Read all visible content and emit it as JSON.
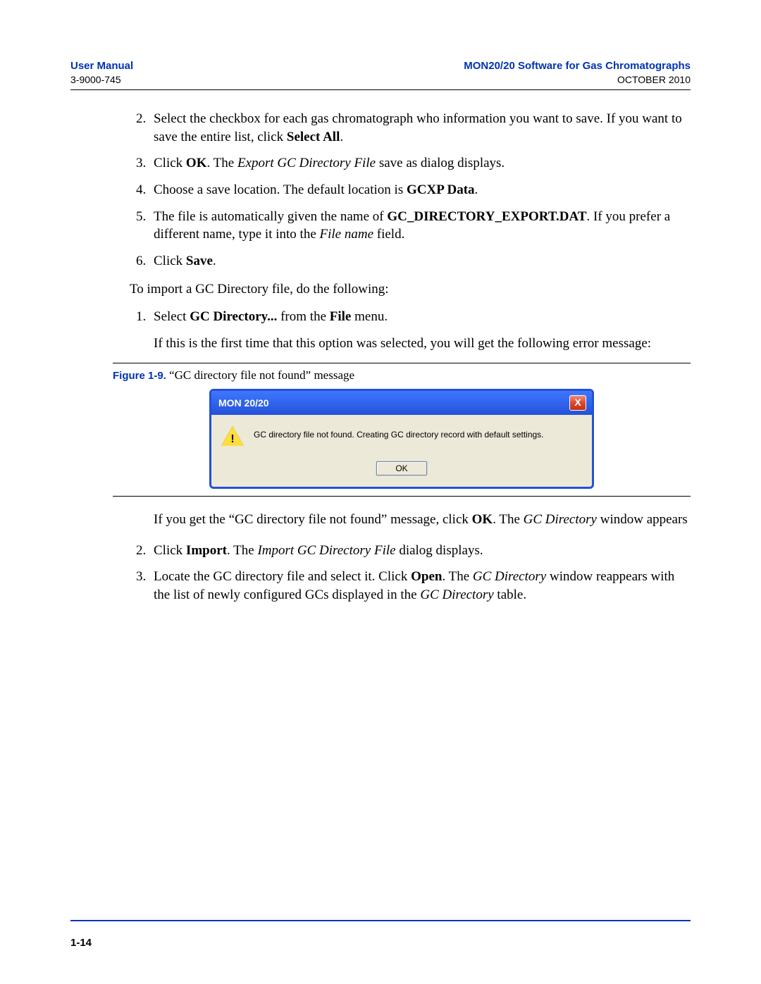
{
  "header": {
    "left_title": "User Manual",
    "left_sub": "3-9000-745",
    "right_title": "MON20/20 Software for Gas Chromatographs",
    "right_sub": "OCTOBER 2010"
  },
  "list1": {
    "i2_a": "Select the checkbox for each gas chromatograph who information you want to save.  If you want to save the entire list, click ",
    "i2_b": "Select All",
    "i2_c": ".",
    "i3_a": "Click ",
    "i3_b": "OK",
    "i3_c": ".  The ",
    "i3_d": "Export GC Directory File",
    "i3_e": " save as dialog displays.",
    "i4_a": "Choose a save location.  The default location is ",
    "i4_b": "GCXP Data",
    "i4_c": ".",
    "i5_a": "The file is automatically given the name of ",
    "i5_b": "GC_DIRECTORY_EXPORT.DAT",
    "i5_c": ".  If you prefer a different name, type it into the ",
    "i5_d": "File name",
    "i5_e": " field.",
    "i6_a": "Click ",
    "i6_b": "Save",
    "i6_c": "."
  },
  "para1": "To import a GC Directory file, do the following:",
  "list2": {
    "i1_a": "Select ",
    "i1_b": "GC Directory...",
    "i1_c": " from the ",
    "i1_d": "File",
    "i1_e": " menu.",
    "i1_sub": "If this is the first time that this option was selected, you will get the following error message:"
  },
  "figure": {
    "label": "Figure 1-9.",
    "caption": "  “GC directory file not found” message",
    "dlg_title": "MON 20/20",
    "dlg_msg": "GC directory file not found.  Creating GC directory record with default settings.",
    "dlg_ok": "OK",
    "dlg_close": "X"
  },
  "list2b": {
    "post_a": "If you get the “GC directory file not found” message, click ",
    "post_b": "OK",
    "post_c": ".  The ",
    "post_d": "GC Directory",
    "post_e": " window appears",
    "i2_a": "Click ",
    "i2_b": "Import",
    "i2_c": ".  The ",
    "i2_d": "Import GC Directory File",
    "i2_e": " dialog displays.",
    "i3_a": "Locate the GC directory file and select it.  Click ",
    "i3_b": "Open",
    "i3_c": ".  The ",
    "i3_d": "GC Directory",
    "i3_e": " window reappears with the list of newly configured GCs displayed in the ",
    "i3_f": "GC Directory",
    "i3_g": " table."
  },
  "pagenum": "1-14"
}
